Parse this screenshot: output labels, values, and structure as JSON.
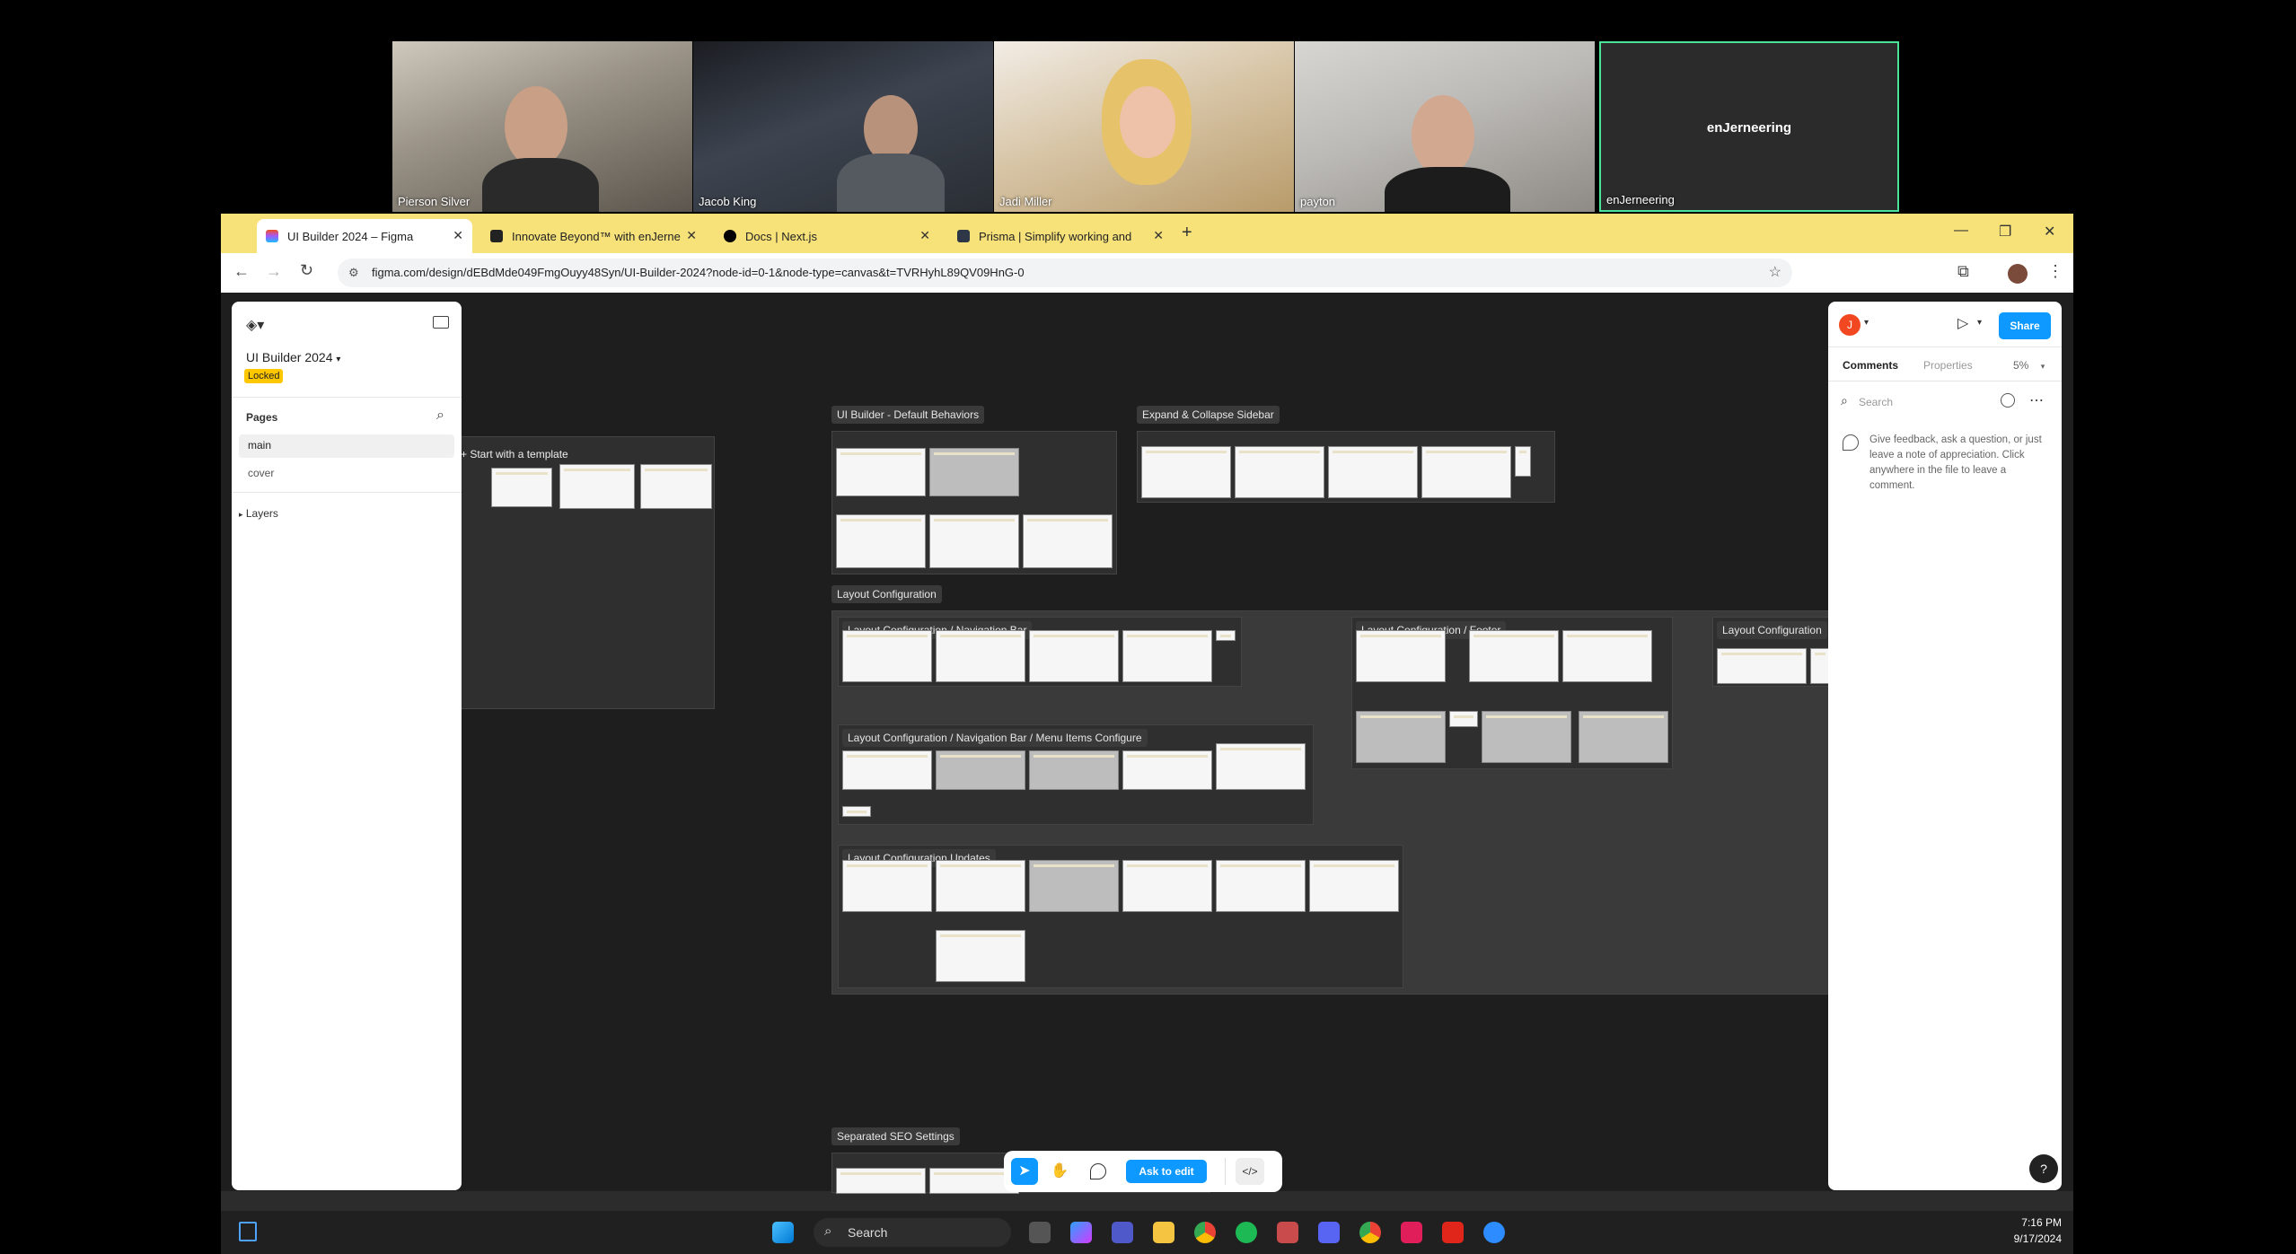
{
  "video_call": {
    "participants": [
      {
        "name": "Pierson Silver"
      },
      {
        "name": "Jacob King"
      },
      {
        "name": "Jadi Miller"
      },
      {
        "name": "payton"
      },
      {
        "name": "enJerneering"
      }
    ],
    "active_speaker_center_label": "enJerneering"
  },
  "browser": {
    "tabs": [
      {
        "label": "UI Builder 2024 – Figma",
        "active": true
      },
      {
        "label": "Innovate Beyond™ with enJerne",
        "active": false
      },
      {
        "label": "Docs | Next.js",
        "active": false
      },
      {
        "label": "Prisma | Simplify working and",
        "active": false
      }
    ],
    "new_tab_label": "+",
    "url": "figma.com/design/dEBdMde049FmgOuyy48Syn/UI-Builder-2024?node-id=0-1&node-type=canvas&t=TVRHyhL89QV09HnG-0"
  },
  "figma": {
    "file_name": "UI Builder 2024",
    "locked_badge": "Locked",
    "pages_header": "Pages",
    "pages": [
      "main",
      "cover"
    ],
    "layers_header": "Layers",
    "right_panel": {
      "avatar_letter": "J",
      "share_label": "Share",
      "tabs": [
        "Comments",
        "Properties"
      ],
      "zoom": "5%",
      "search_placeholder": "Search",
      "empty_message": "Give feedback, ask a question, or just leave a note of appreciation. Click anywhere in the file to leave a comment."
    },
    "canvas_sections": {
      "start_template": "+ Start with a template",
      "default_behaviors": "UI Builder - Default Behaviors",
      "expand_collapse": "Expand & Collapse Sidebar",
      "layout_config": "Layout Configuration",
      "nav_bar": "Layout Configuration / Navigation Bar",
      "footer": "Layout Configuration / Footer",
      "layout_config_cut": "Layout Configuration",
      "menu_items": "Layout Configuration / Navigation Bar / Menu Items Configure",
      "updates": "Layout Configuration Updates",
      "seo": "Separated SEO Settings"
    },
    "toolbar": {
      "ask_to_edit": "Ask to edit"
    },
    "help_label": "?"
  },
  "taskbar": {
    "search_placeholder": "Search",
    "time": "7:16 PM",
    "date": "9/17/2024"
  },
  "colors": {
    "tab_bar": "#f7e27a",
    "share_blue": "#0d99ff",
    "locked_badge": "#ffc700",
    "active_speaker_border": "#4be39a"
  }
}
